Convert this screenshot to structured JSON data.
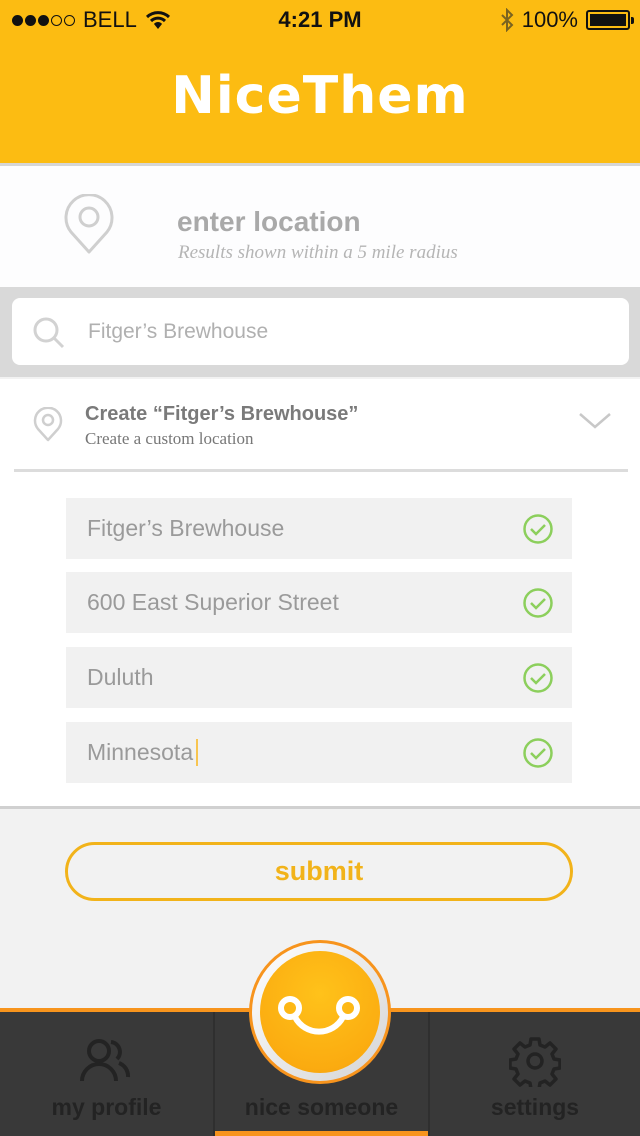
{
  "status_bar": {
    "carrier": "BELL",
    "signal_bars_filled": 3,
    "signal_bars_total": 5,
    "time": "4:21 PM",
    "battery_percent": "100%"
  },
  "header": {
    "app_name": "NiceThem"
  },
  "location": {
    "title": "enter location",
    "subtitle": "Results shown within a 5 mile radius"
  },
  "search": {
    "value": "",
    "placeholder": "Fitger’s Brewhouse"
  },
  "create": {
    "title": "Create “Fitger’s Brewhouse”",
    "subtitle": "Create a custom location"
  },
  "fields": [
    {
      "value": "Fitger’s Brewhouse",
      "valid": true
    },
    {
      "value": "600 East Superior Street",
      "valid": true
    },
    {
      "value": "Duluth",
      "valid": true
    },
    {
      "value": "Minnesota",
      "valid": true
    }
  ],
  "submit": {
    "label": "submit"
  },
  "tabs": [
    {
      "label": "my profile",
      "icon": "users-icon",
      "active": false
    },
    {
      "label": "nice someone",
      "icon": "smiley-icon",
      "active": true
    },
    {
      "label": "settings",
      "icon": "gear-icon",
      "active": false
    }
  ],
  "colors": {
    "brand_yellow": "#fcbc12",
    "accent_orange": "#f7941d",
    "valid_green": "#8ccf5c",
    "tabbar_bg": "#393939"
  }
}
